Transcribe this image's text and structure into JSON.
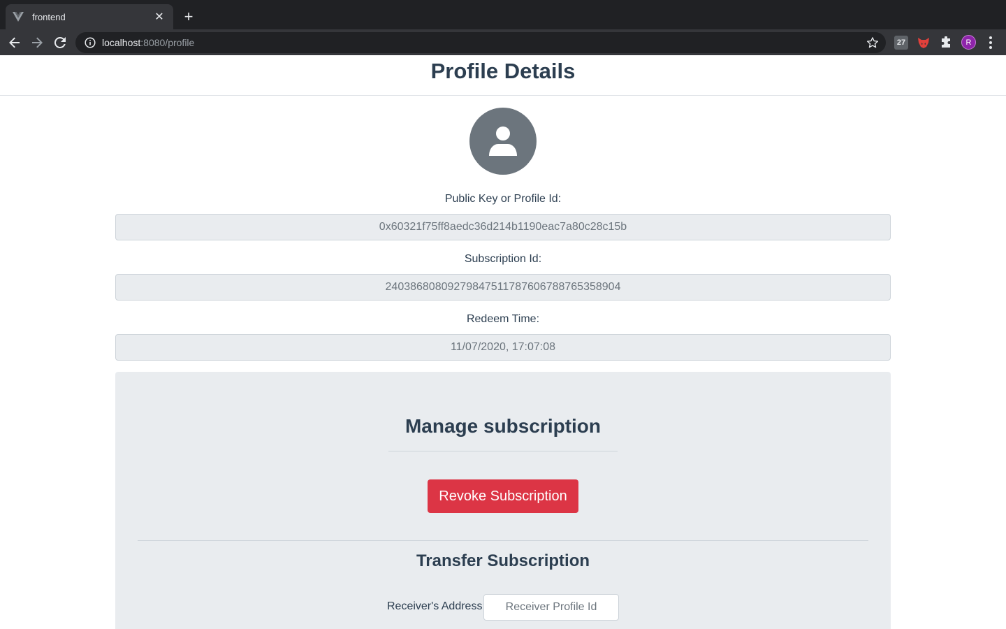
{
  "browser": {
    "tab_title": "frontend",
    "tab_close": "✕",
    "new_tab": "+",
    "url_host": "localhost",
    "url_rest": ":8080/profile",
    "extensions": [
      "27"
    ],
    "profile_initial": "R"
  },
  "page": {
    "title": "Profile Details",
    "fields": [
      {
        "label": "Public Key or Profile Id:",
        "value": "0x60321f75ff8aedc36d214b1190eac7a80c28c15b"
      },
      {
        "label": "Subscription Id:",
        "value": "24038680809279847511787606788765358904"
      },
      {
        "label": "Redeem Time:",
        "value": "11/07/2020, 17:07:08"
      }
    ]
  },
  "manage": {
    "title": "Manage subscription",
    "revoke_label": "Revoke Subscription",
    "transfer_title": "Transfer Subscription",
    "receiver_label": "Receiver's Address:",
    "receiver_placeholder": "Receiver Profile Id"
  },
  "colors": {
    "danger": "#dc3545",
    "avatar_bg": "#6c757d",
    "text": "#2c3e50"
  }
}
